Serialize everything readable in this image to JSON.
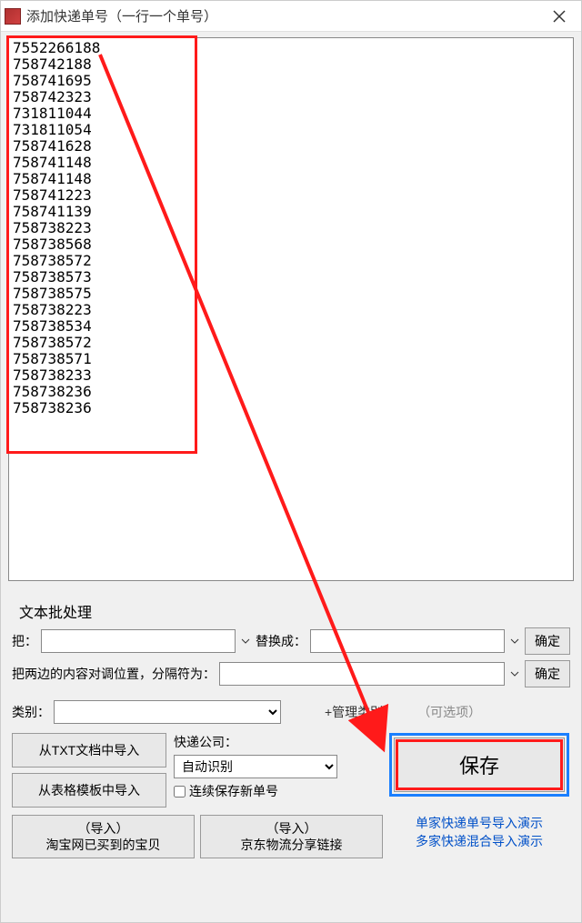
{
  "titlebar": {
    "title": "添加快递单号（一行一个单号）"
  },
  "tracking_numbers": "7552266188\n758742188\n758741695\n758742323\n731811044\n731811054\n758741628\n758741148\n758741148\n758741223\n758741139\n758738223\n758738568\n758738572\n758738573\n758738575\n758738223\n758738534\n758738572\n758738571\n758738233\n758738236\n758738236",
  "text_batch": {
    "title": "文本批处理",
    "replace_from_label": "把：",
    "replace_to_label": "替换成：",
    "confirm": "确定",
    "swap_label": "把两边的内容对调位置，分隔符为：",
    "confirm2": "确定"
  },
  "category": {
    "label": "类别：",
    "manage": "+管理类别",
    "optional": "（可选项）"
  },
  "courier": {
    "label": "快递公司：",
    "selected": "自动识别",
    "continuous": "连续保存新单号"
  },
  "buttons": {
    "import_txt": "从TXT文档中导入",
    "import_sheet": "从表格模板中导入",
    "save": "保存",
    "taobao_sub": "（导入）",
    "taobao": "淘宝网已买到的宝贝",
    "jd_sub": "（导入）",
    "jd": "京东物流分享链接"
  },
  "demo_links": {
    "single": "单家快递单号导入演示",
    "multi": "多家快递混合导入演示"
  }
}
